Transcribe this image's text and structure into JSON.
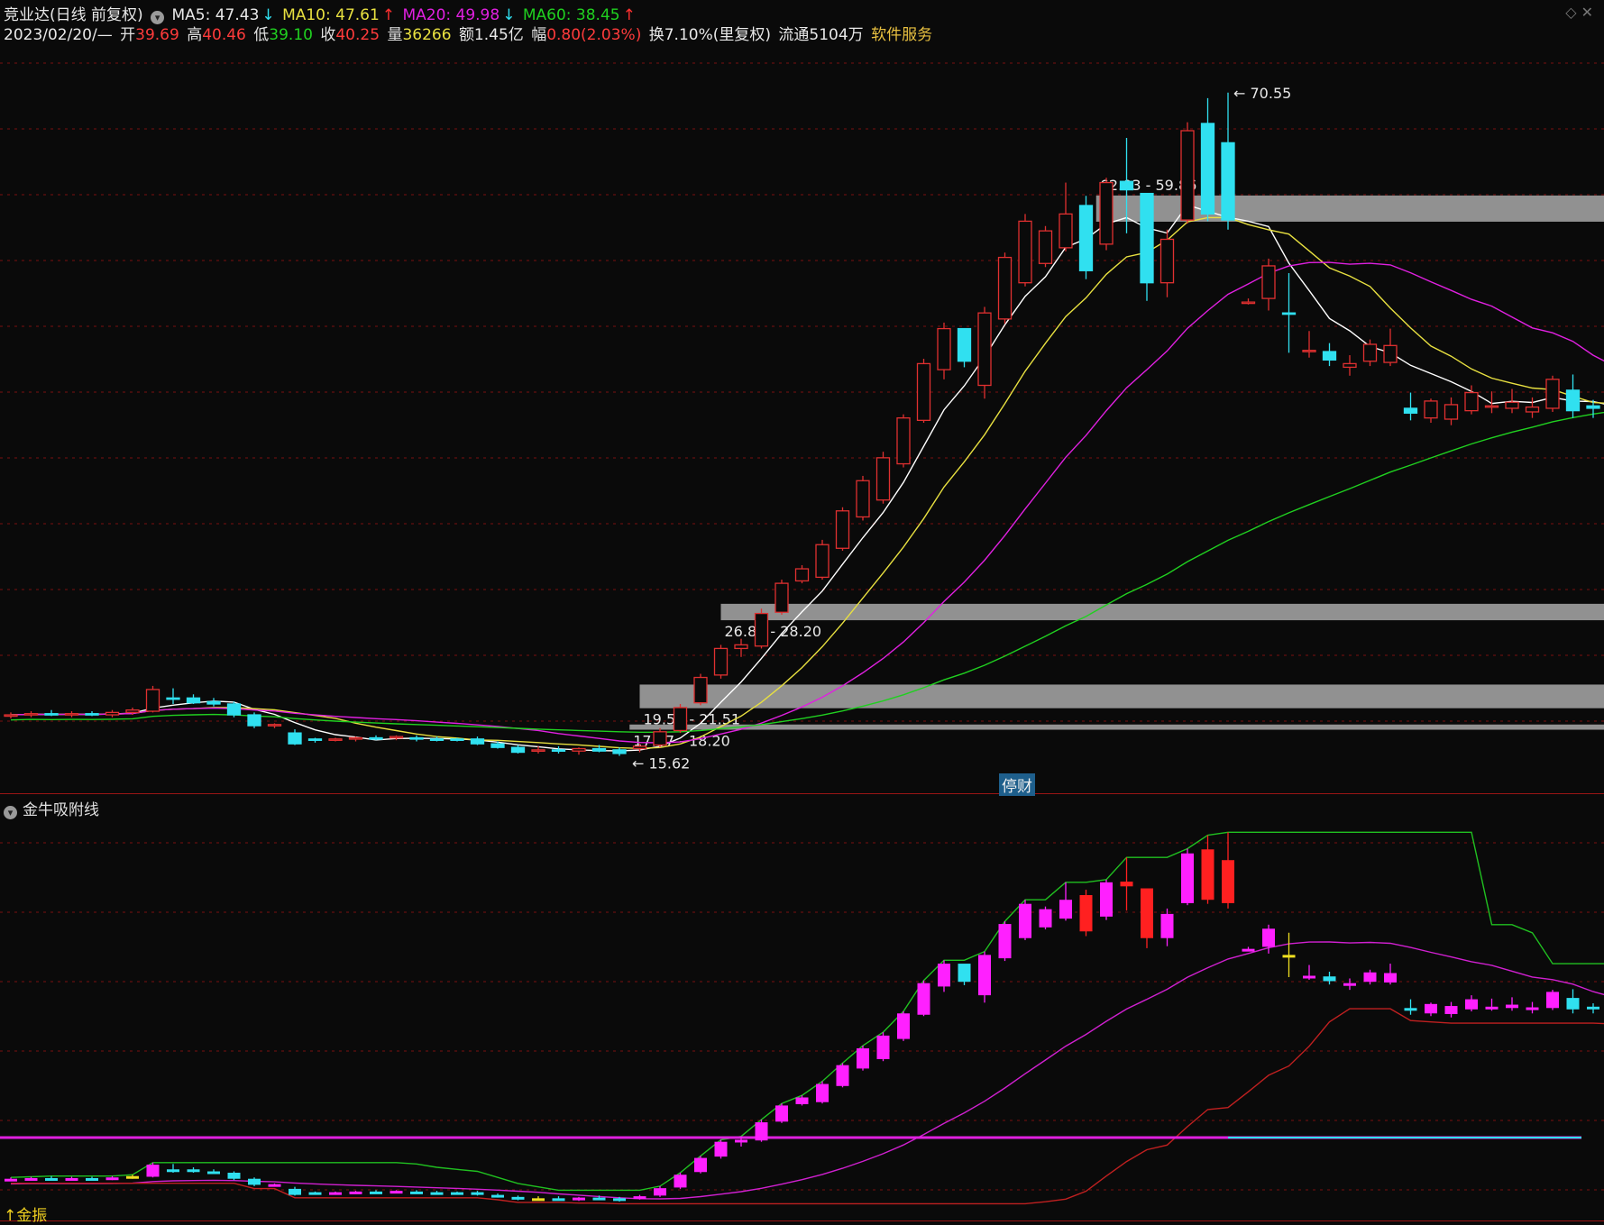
{
  "header": {
    "stock_name": "竞业达(日线 前复权)",
    "ma5": "MA5: 47.43",
    "ma10": "MA10: 47.61",
    "ma20": "MA20: 49.98",
    "ma60": "MA60: 38.45",
    "date": "2023/02/20/—",
    "open_label": "开",
    "open": "39.69",
    "high_label": "高",
    "high": "40.46",
    "low_label": "低",
    "low": "39.10",
    "close_label": "收",
    "close": "40.25",
    "volume_label": "量",
    "volume": "36266",
    "amount": "额1.45亿",
    "change_label": "幅",
    "change": "0.80(2.03%)",
    "turnover": "换7.10%(里复权)",
    "float_shares": "流通5104万",
    "service": "软件服务"
  },
  "annotations": {
    "stop_label": "停财",
    "panel2_title": "金牛吸附线",
    "bottom_label": "↑金振"
  },
  "colors": {
    "up": "#e03030",
    "down": "#30e0f0",
    "ma5": "#ffffff",
    "ma10": "#e8e040",
    "ma20": "#e020e0",
    "ma60": "#20d020",
    "zone": "#a0a0a0",
    "grid": "#7a1010"
  },
  "chart_data": [
    {
      "type": "candlestick",
      "title": "竞业达(日线 前复权)",
      "y_range": [
        14,
        73
      ],
      "high_label": "70.55",
      "low_label": "15.62",
      "zones": [
        {
          "label": "62.03 - 59.86",
          "low": 59.86,
          "high": 62.03
        },
        {
          "label": "26.84 - 28.20",
          "low": 26.84,
          "high": 28.2
        },
        {
          "label": "19.55 - 21.51",
          "low": 19.55,
          "high": 21.51
        },
        {
          "label": "17.77 - 18.20",
          "low": 17.77,
          "high": 18.2
        }
      ],
      "candles": [
        [
          18.9,
          19.2,
          18.7,
          19.0
        ],
        [
          19.0,
          19.3,
          18.8,
          19.1
        ],
        [
          19.1,
          19.4,
          18.9,
          19.0
        ],
        [
          19.0,
          19.3,
          18.8,
          19.1
        ],
        [
          19.1,
          19.3,
          18.9,
          19.0
        ],
        [
          19.0,
          19.4,
          18.8,
          19.2
        ],
        [
          19.2,
          19.6,
          19.0,
          19.4
        ],
        [
          19.3,
          21.4,
          19.2,
          21.1
        ],
        [
          20.4,
          21.2,
          19.9,
          20.3
        ],
        [
          20.4,
          20.7,
          19.9,
          20.0
        ],
        [
          20.1,
          20.4,
          19.7,
          19.9
        ],
        [
          19.9,
          20.1,
          18.8,
          19.0
        ],
        [
          19.0,
          19.2,
          17.9,
          18.1
        ],
        [
          18.1,
          18.3,
          17.9,
          18.2
        ],
        [
          17.5,
          17.8,
          16.5,
          16.6
        ],
        [
          17.0,
          17.1,
          16.7,
          16.9
        ],
        [
          17.0,
          17.1,
          16.8,
          17.0
        ],
        [
          17.0,
          17.2,
          16.8,
          17.1
        ],
        [
          17.1,
          17.3,
          16.9,
          17.0
        ],
        [
          17.1,
          17.3,
          16.9,
          17.2
        ],
        [
          17.1,
          17.3,
          16.8,
          17.0
        ],
        [
          17.0,
          17.2,
          16.8,
          16.9
        ],
        [
          17.0,
          17.1,
          16.8,
          16.9
        ],
        [
          17.0,
          17.2,
          16.5,
          16.6
        ],
        [
          16.6,
          16.8,
          16.2,
          16.3
        ],
        [
          16.3,
          16.5,
          15.8,
          15.9
        ],
        [
          16.0,
          16.4,
          15.8,
          16.1
        ],
        [
          16.1,
          16.4,
          15.8,
          16.0
        ],
        [
          16.0,
          16.3,
          15.7,
          16.2
        ],
        [
          16.2,
          16.5,
          15.9,
          16.0
        ],
        [
          16.1,
          16.3,
          15.6,
          15.8
        ],
        [
          16.2,
          16.6,
          15.9,
          16.4
        ],
        [
          16.5,
          17.9,
          16.3,
          17.6
        ],
        [
          17.7,
          19.9,
          17.5,
          19.6
        ],
        [
          20.0,
          22.4,
          19.8,
          22.1
        ],
        [
          22.3,
          24.8,
          22.0,
          24.5
        ],
        [
          24.5,
          25.3,
          23.8,
          24.8
        ],
        [
          24.7,
          27.8,
          24.5,
          27.4
        ],
        [
          27.5,
          30.2,
          27.3,
          29.9
        ],
        [
          30.1,
          31.4,
          29.9,
          31.1
        ],
        [
          30.4,
          33.5,
          30.2,
          33.1
        ],
        [
          32.8,
          36.2,
          32.6,
          35.9
        ],
        [
          35.4,
          38.8,
          35.1,
          38.4
        ],
        [
          36.8,
          40.8,
          36.5,
          40.3
        ],
        [
          39.8,
          43.9,
          39.5,
          43.6
        ],
        [
          43.4,
          48.5,
          43.2,
          48.1
        ],
        [
          47.6,
          51.5,
          46.8,
          51.0
        ],
        [
          51.0,
          50.8,
          47.8,
          48.3
        ],
        [
          46.3,
          52.8,
          45.2,
          52.3
        ],
        [
          51.8,
          57.3,
          51.4,
          56.9
        ],
        [
          54.8,
          60.5,
          54.5,
          59.9
        ],
        [
          56.4,
          59.5,
          56.1,
          59.1
        ],
        [
          57.7,
          63.1,
          57.4,
          60.5
        ],
        [
          61.2,
          62.0,
          55.1,
          55.8
        ],
        [
          58.0,
          63.5,
          57.5,
          63.1
        ],
        [
          63.2,
          66.8,
          58.9,
          62.5
        ],
        [
          62.2,
          58.4,
          53.3,
          54.8
        ],
        [
          54.8,
          59.2,
          53.6,
          58.4
        ],
        [
          60.0,
          68.1,
          59.7,
          67.4
        ],
        [
          68.0,
          70.1,
          59.9,
          60.5
        ],
        [
          66.4,
          70.55,
          59.2,
          60.0
        ],
        [
          53.2,
          53.5,
          53.0,
          53.2
        ],
        [
          53.5,
          56.8,
          52.5,
          56.2
        ],
        [
          52.3,
          55.6,
          49.0,
          52.2
        ],
        [
          49.2,
          50.8,
          48.6,
          49.2
        ],
        [
          49.1,
          49.8,
          47.9,
          48.4
        ],
        [
          47.8,
          48.8,
          47.1,
          48.1
        ],
        [
          48.3,
          50.1,
          47.9,
          49.7
        ],
        [
          48.2,
          51.0,
          47.9,
          49.6
        ],
        [
          44.4,
          45.7,
          43.4,
          44.0
        ],
        [
          43.6,
          45.2,
          43.2,
          45.0
        ],
        [
          43.5,
          45.3,
          43.0,
          44.7
        ],
        [
          44.2,
          46.3,
          43.9,
          45.7
        ],
        [
          44.5,
          45.8,
          44.0,
          44.6
        ],
        [
          44.4,
          46.0,
          44.0,
          44.9
        ],
        [
          44.1,
          45.3,
          43.6,
          44.5
        ],
        [
          44.4,
          47.1,
          44.1,
          46.8
        ],
        [
          45.9,
          47.2,
          43.6,
          44.2
        ],
        [
          44.6,
          45.1,
          43.6,
          44.4
        ],
        [
          43.9,
          44.2,
          42.9,
          43.1
        ],
        [
          41.6,
          44.0,
          41.3,
          43.4
        ]
      ]
    },
    {
      "type": "candlestick",
      "title": "金牛吸附线"
    }
  ]
}
